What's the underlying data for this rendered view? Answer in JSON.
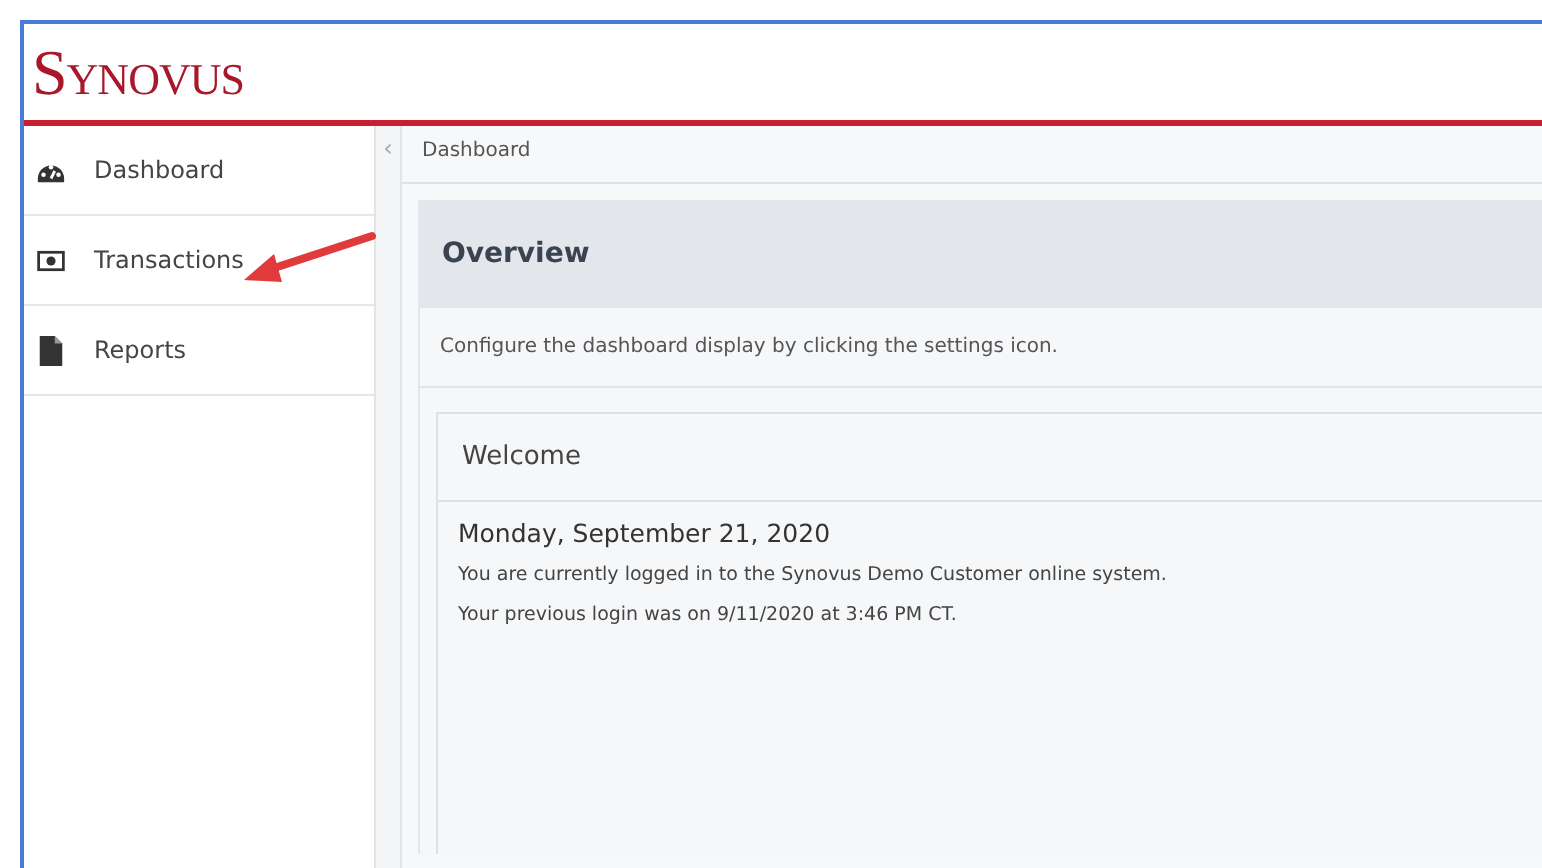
{
  "logo": "Synovus",
  "sidebar": {
    "items": [
      {
        "label": "Dashboard",
        "selected": false
      },
      {
        "label": "Transactions",
        "selected": false
      },
      {
        "label": "Reports",
        "selected": false
      }
    ]
  },
  "breadcrumb": "Dashboard",
  "collapse_toggle": "‹",
  "overview": {
    "title": "Overview",
    "hint": "Configure the dashboard display by clicking the settings icon."
  },
  "welcome": {
    "title": "Welcome",
    "date": "Monday, September 21, 2020",
    "lines": [
      "You are currently logged in to the Synovus Demo Customer online system.",
      "Your previous login was on 9/11/2020 at 3:46 PM CT."
    ]
  }
}
